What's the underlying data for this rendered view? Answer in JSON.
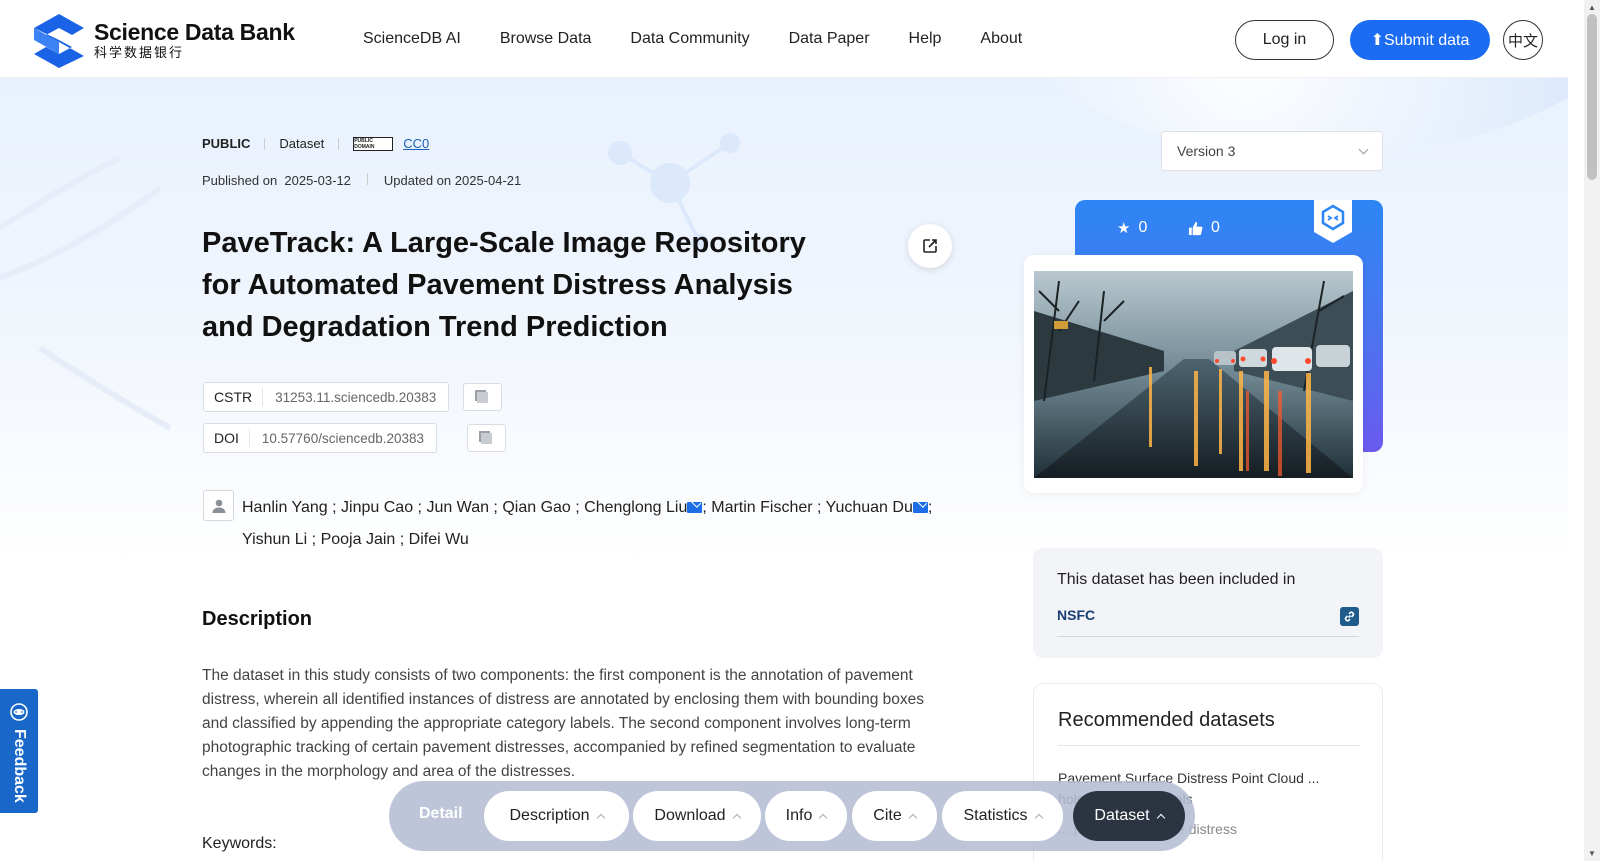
{
  "header": {
    "logo_title": "Science Data Bank",
    "logo_subtitle": "科学数据银行",
    "nav": [
      "ScienceDB AI",
      "Browse Data",
      "Data Community",
      "Data Paper",
      "Help",
      "About"
    ],
    "login_label": "Log in",
    "submit_label": "Submit data",
    "submit_icon": "upload-arrow-icon",
    "lang_label": "中文"
  },
  "meta": {
    "access": "PUBLIC",
    "type": "Dataset",
    "license_badge": "PUBLIC DOMAIN",
    "license": "CC0",
    "published_label": "Published on",
    "published_date": "2025-03-12",
    "updated_label": "Updated on",
    "updated_date": "2025-04-21"
  },
  "dataset": {
    "title": "PaveTrack: A Large-Scale Image Repository for Automated Pavement Distress Analysis and Degradation Trend Prediction",
    "cstr_label": "CSTR",
    "cstr_value": "31253.11.sciencedb.20383",
    "doi_label": "DOI",
    "doi_value": "10.57760/sciencedb.20383",
    "authors": [
      {
        "name": "Hanlin Yang",
        "email": false
      },
      {
        "name": "Jinpu Cao",
        "email": false
      },
      {
        "name": "Jun Wan",
        "email": false
      },
      {
        "name": "Qian Gao",
        "email": false
      },
      {
        "name": "Chenglong Liu",
        "email": true
      },
      {
        "name": "Martin Fischer",
        "email": false
      },
      {
        "name": "Yuchuan Du",
        "email": true
      },
      {
        "name": "Yishun Li",
        "email": false
      },
      {
        "name": "Pooja Jain",
        "email": false
      },
      {
        "name": "Difei Wu",
        "email": false
      }
    ],
    "description_heading": "Description",
    "description": "The dataset in this study consists of two components: the first component is the annotation of pavement distress, wherein all identified instances of distress are annotated by enclosing them with bounding boxes and classified by appending the appropriate category labels. The second component involves long-term photographic tracking of certain pavement distresses, accompanied by refined segmentation to evaluate changes in the morphology and area of the distresses.",
    "keywords_label": "Keywords:"
  },
  "sidebar": {
    "version": "Version 3",
    "stars": "0",
    "likes": "0",
    "star_icon": "star-icon",
    "like_icon": "thumbs-up-icon",
    "included_title": "This dataset has been included in",
    "included_item": "NSFC",
    "recommended_heading": "Recommended datasets",
    "recommended_title": "Pavement Surface Distress Point Cloud ... holes, and Upheavals",
    "recommended_sub": "... pavement surface distress"
  },
  "feedback_label": "Feedback",
  "toolbar": {
    "detail": "Detail",
    "tabs": [
      "Description",
      "Download",
      "Info",
      "Cite",
      "Statistics",
      "Dataset"
    ],
    "active_tab": "Dataset"
  },
  "colors": {
    "primary": "#1b6cf2",
    "stats_card_start": "#2d86f5",
    "stats_card_end": "#6b5af0",
    "toolbar_active": "#2c3442",
    "feedback": "#1867c9"
  }
}
